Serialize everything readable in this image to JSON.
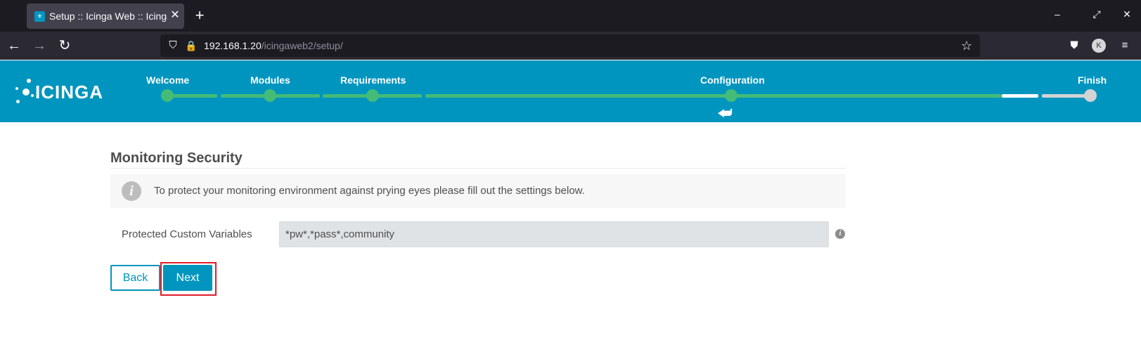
{
  "browser": {
    "tab_title": "Setup :: Icinga Web :: Icinga",
    "url_host": "192.168.1.20",
    "url_path": "/icingaweb2/setup/",
    "icons": {
      "new_tab": "+",
      "close": "✕",
      "minimize": "–",
      "maximize": "⤢",
      "window_close": "✕",
      "back": "←",
      "forward": "→",
      "reload": "↻",
      "shield": "⛉",
      "lock": "🔒",
      "star": "☆",
      "pocket": "⛊",
      "menu": "≡",
      "avatar": "K"
    }
  },
  "header": {
    "logo_text": "ICINGA",
    "steps": [
      {
        "label": "Welcome",
        "state": "done"
      },
      {
        "label": "Modules",
        "state": "done"
      },
      {
        "label": "Requirements",
        "state": "done"
      },
      {
        "label": "Configuration",
        "state": "current"
      },
      {
        "label": "Finish",
        "state": "pending"
      }
    ],
    "current_step_marker": "⮨",
    "accent_color": "#0095bf",
    "progress_color": "#44bb77"
  },
  "main": {
    "title": "Monitoring Security",
    "info_icon": "i",
    "info_text": "To protect your monitoring environment against prying eyes please fill out the settings below.",
    "field": {
      "label": "Protected Custom Variables",
      "value": "*pw*,*pass*,community",
      "help_icon": "i"
    },
    "buttons": {
      "back": "Back",
      "next": "Next"
    }
  }
}
